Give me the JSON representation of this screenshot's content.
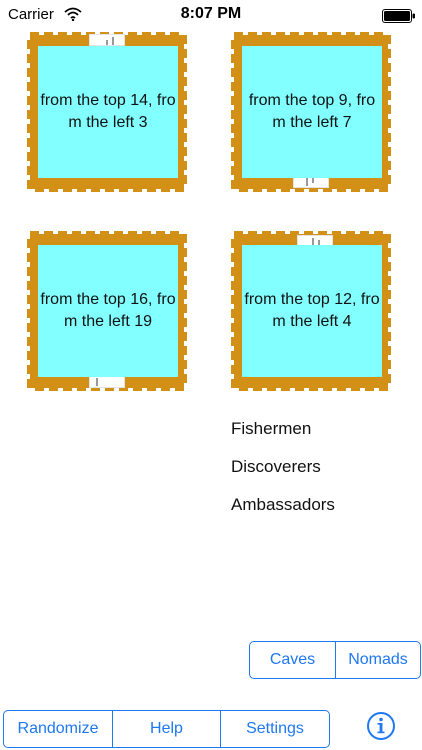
{
  "status_bar": {
    "carrier": "Carrier",
    "time": "8:07 PM"
  },
  "tiles": [
    {
      "text": "from the top 14, from the left 3"
    },
    {
      "text": "from the top 9, from the left 7"
    },
    {
      "text": "from the top 16, from the left 19"
    },
    {
      "text": "from the top 12, from the left 4"
    }
  ],
  "words": [
    "Fishermen",
    "Discoverers",
    "Ambassadors"
  ],
  "mode_control": {
    "options": [
      "Caves",
      "Nomads"
    ]
  },
  "toolbar": {
    "buttons": [
      "Randomize",
      "Help",
      "Settings"
    ],
    "info_icon": "info-icon"
  },
  "colors": {
    "accent": "#1e78f2",
    "tile_fill": "#82ffff",
    "stamp_border": "#d39016"
  }
}
